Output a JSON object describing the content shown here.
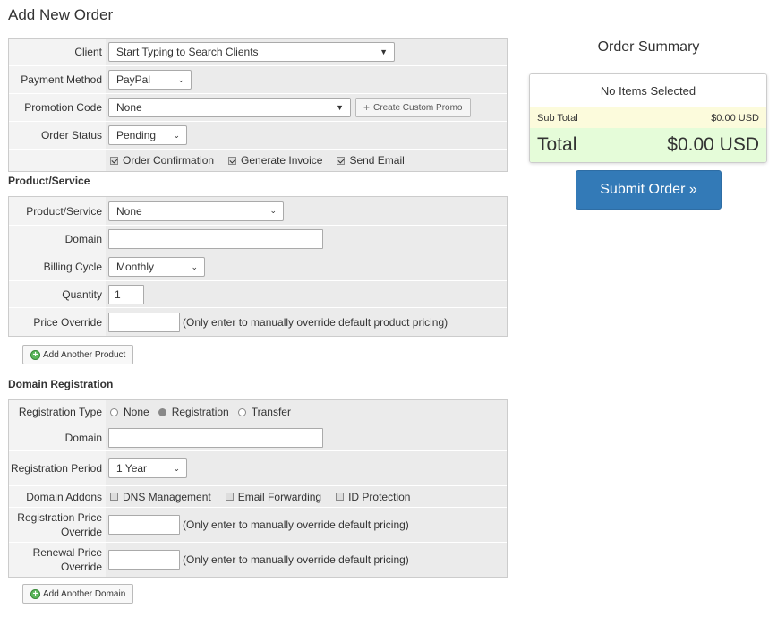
{
  "page": {
    "title": "Add New Order"
  },
  "order": {
    "client_label": "Client",
    "client_placeholder": "Start Typing to Search Clients",
    "payment_label": "Payment Method",
    "payment_value": "PayPal",
    "promo_label": "Promotion Code",
    "promo_value": "None",
    "promo_button": "Create Custom Promo",
    "status_label": "Order Status",
    "status_value": "Pending",
    "checks": [
      {
        "label": "Order Confirmation",
        "checked": true
      },
      {
        "label": "Generate Invoice",
        "checked": true
      },
      {
        "label": "Send Email",
        "checked": true
      }
    ]
  },
  "product": {
    "section_title": "Product/Service",
    "product_label": "Product/Service",
    "product_value": "None",
    "domain_label": "Domain",
    "domain_value": "",
    "cycle_label": "Billing Cycle",
    "cycle_value": "Monthly",
    "qty_label": "Quantity",
    "qty_value": "1",
    "price_label": "Price Override",
    "price_value": "",
    "price_hint": "(Only enter to manually override default product pricing)",
    "add_button": "Add Another Product"
  },
  "domain": {
    "section_title": "Domain Registration",
    "type_label": "Registration Type",
    "types": [
      {
        "label": "None",
        "selected": false
      },
      {
        "label": "Registration",
        "selected": true
      },
      {
        "label": "Transfer",
        "selected": false
      }
    ],
    "domain_label": "Domain",
    "domain_value": "",
    "period_label": "Registration Period",
    "period_value": "1 Year",
    "addons_label": "Domain Addons",
    "addons": [
      {
        "label": "DNS Management",
        "checked": false
      },
      {
        "label": "Email Forwarding",
        "checked": false
      },
      {
        "label": "ID Protection",
        "checked": false
      }
    ],
    "reg_price_label": "Registration Price Override",
    "reg_price_value": "",
    "reg_price_hint": "(Only enter to manually override default pricing)",
    "renew_price_label": "Renewal Price Override",
    "renew_price_value": "",
    "renew_price_hint": "(Only enter to manually override default pricing)",
    "add_button": "Add Another Domain"
  },
  "summary": {
    "title": "Order Summary",
    "empty_text": "No Items Selected",
    "subtotal_label": "Sub Total",
    "subtotal_value": "$0.00 USD",
    "total_label": "Total",
    "total_value": "$0.00 USD",
    "submit_label": "Submit Order »"
  },
  "colors": {
    "accent": "#337ab7",
    "subtotal_bg": "#fcfbdc",
    "total_bg": "#e5fcd9",
    "add_icon": "#5cb85c"
  },
  "icons": {
    "add": "plus-circle-icon",
    "promo": "plus-icon",
    "dropdown": "chevron-down-icon"
  }
}
